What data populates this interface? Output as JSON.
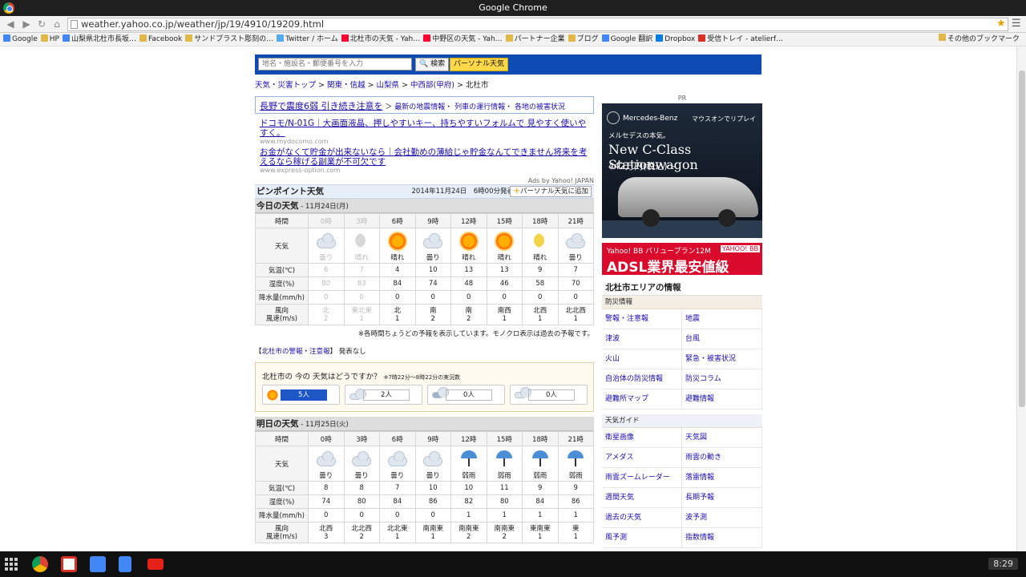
{
  "window": {
    "title": "Google Chrome"
  },
  "browser": {
    "url": "weather.yahoo.co.jp/weather/jp/19/4910/19209.html",
    "bookmarks": [
      {
        "label": "Google",
        "color": "#4285f4"
      },
      {
        "label": "HP",
        "color": "#e0b84a"
      },
      {
        "label": "山梨県北杜市長坂…",
        "color": "#4285f4"
      },
      {
        "label": "Facebook",
        "color": "#e0b84a"
      },
      {
        "label": "サンドブラスト彫刻の…",
        "color": "#e0b84a"
      },
      {
        "label": "Twitter / ホーム",
        "color": "#55acee"
      },
      {
        "label": "北杜市の天気 - Yah…",
        "color": "#ff0033"
      },
      {
        "label": "中野区の天気 - Yah…",
        "color": "#ff0033"
      },
      {
        "label": "パートナー企業",
        "color": "#e0b84a"
      },
      {
        "label": "ブログ",
        "color": "#e0b84a"
      },
      {
        "label": "Google 翻訳",
        "color": "#4285f4"
      },
      {
        "label": "Dropbox",
        "color": "#007ee5"
      },
      {
        "label": "受信トレイ - atelierf…",
        "color": "#d93025"
      }
    ],
    "other_bookmarks": "その他のブックマーク"
  },
  "page": {
    "search": {
      "placeholder": "地名・施設名・郵便番号を入力",
      "button": "検索",
      "personal": "パーソナル天気"
    },
    "breadcrumb": [
      "天気・災害トップ",
      "関東・信越",
      "山梨県",
      "中西部(甲府)",
      "北杜市"
    ],
    "alert": {
      "headline": "長野で震度6弱 引き続き注意を",
      "links": [
        "最新の地震情報",
        "列車の運行情報",
        "各地の被害状況"
      ]
    },
    "ads": [
      {
        "title": "ドコモ/N-01G｜大画面液晶、押しやすいキー、持ちやすいフォルムで 見やすく使いやすく。",
        "url": "www.mydocomo.com"
      },
      {
        "title": "お金がなくて貯金が出来ないなら｜会社勤めの薄給じゃ貯金なんてできません将来を考えるなら稼げる副業が不可欠です",
        "url": "www.express-option.com"
      }
    ],
    "ads_by": "Ads by Yahoo! JAPAN",
    "pinpoint": {
      "title": "ピンポイント天気",
      "published": "2014年11月24日　6時00分発表",
      "add_button": "パーソナル天気に追加"
    },
    "row_labels": {
      "hour": "時間",
      "weather": "天気",
      "temp": "気温(℃)",
      "humidity": "湿度(%)",
      "precip": "降水量(mm/h)",
      "wind1": "風向",
      "wind2": "風速(m/s)"
    },
    "today": {
      "title": "今日の天気",
      "date": " - 11月24日(月)",
      "hours": [
        "0時",
        "3時",
        "6時",
        "9時",
        "12時",
        "15時",
        "18時",
        "21時"
      ],
      "icons": [
        "cloud",
        "moon-grey",
        "sun",
        "cloud",
        "sun",
        "sun",
        "moon",
        "cloud"
      ],
      "weather": [
        "曇り",
        "晴れ",
        "晴れ",
        "曇り",
        "晴れ",
        "晴れ",
        "晴れ",
        "曇り"
      ],
      "temp": [
        "6",
        "7",
        "4",
        "10",
        "13",
        "13",
        "9",
        "7"
      ],
      "humidity": [
        "80",
        "83",
        "84",
        "74",
        "48",
        "46",
        "58",
        "70"
      ],
      "precip": [
        "0",
        "0",
        "0",
        "0",
        "0",
        "0",
        "0",
        "0"
      ],
      "wind_dir": [
        "北",
        "東北東",
        "北",
        "南",
        "南",
        "南西",
        "北西",
        "北北西"
      ],
      "wind_speed": [
        "2",
        "1",
        "1",
        "2",
        "2",
        "1",
        "1",
        "1"
      ]
    },
    "note": "※各時間ちょうどの予報を表示しています。モノクロ表示は過去の予報です。",
    "warning": {
      "link": "北杜市の警報・注意報",
      "status": "発表なし"
    },
    "poll": {
      "question": "北杜市の 今の 天気はどうですか？",
      "sub": "※7時22分～8時22分の実況数",
      "counts": [
        "5人",
        "2人",
        "0人",
        "0人"
      ]
    },
    "tomorrow": {
      "title": "明日の天気",
      "date": " - 11月25日(火)",
      "hours": [
        "0時",
        "3時",
        "6時",
        "9時",
        "12時",
        "15時",
        "18時",
        "21時"
      ],
      "icons": [
        "cloud",
        "cloud",
        "cloud",
        "cloud",
        "umbrella",
        "umbrella",
        "umbrella",
        "umbrella"
      ],
      "weather": [
        "曇り",
        "曇り",
        "曇り",
        "曇り",
        "弱雨",
        "弱雨",
        "弱雨",
        "弱雨"
      ],
      "temp": [
        "8",
        "8",
        "7",
        "10",
        "10",
        "11",
        "9",
        "9"
      ],
      "humidity": [
        "74",
        "80",
        "84",
        "86",
        "82",
        "80",
        "84",
        "86"
      ],
      "precip": [
        "0",
        "0",
        "0",
        "0",
        "1",
        "1",
        "1",
        "1"
      ],
      "wind_dir": [
        "北西",
        "北北西",
        "北北東",
        "南南東",
        "南南東",
        "南南東",
        "東南東",
        "東"
      ],
      "wind_speed": [
        "3",
        "2",
        "1",
        "1",
        "2",
        "2",
        "1",
        "1"
      ]
    },
    "pr": "PR",
    "benz": {
      "brand": "Mercedes-Benz",
      "replay": "マウスオンでリプレイ",
      "catch": "メルセデスの本気。",
      "model": "New C-Class Stationwagon",
      "price": "442万円(税込)～"
    },
    "adsl": {
      "line1": "Yahoo! BB バリュープラン12M",
      "line2": "ADSL業界最安値級",
      "badge": "YAHOO! BB"
    },
    "area": {
      "title": "北杜市エリアの情報",
      "disaster_head": "防災情報",
      "disaster_links": [
        "警報・注意報",
        "地震",
        "津波",
        "台風",
        "火山",
        "緊急・被害状況",
        "自治体の防災情報",
        "防災コラム",
        "避難所マップ",
        "避難情報"
      ],
      "guide_head": "天気ガイド",
      "guide_links": [
        "衛星画像",
        "天気図",
        "アメダス",
        "雨雲の動き",
        "雨雲ズームレーダー",
        "落雷情報",
        "週間天気",
        "長期予報",
        "過去の天気",
        "波予測",
        "風予測",
        "指数情報"
      ]
    }
  },
  "taskbar": {
    "clock": "8:29"
  }
}
